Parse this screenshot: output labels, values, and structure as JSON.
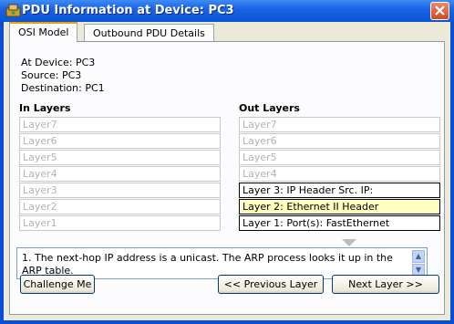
{
  "window": {
    "title": "PDU Information at Device: PC3"
  },
  "tabs": [
    {
      "label": "OSI Model",
      "active": true
    },
    {
      "label": "Outbound PDU Details",
      "active": false
    }
  ],
  "info": {
    "device": "At Device: PC3",
    "source": "Source: PC3",
    "destination": "Destination: PC1"
  },
  "in_layers": {
    "header": "In Layers",
    "items": [
      "Layer7",
      "Layer6",
      "Layer5",
      "Layer4",
      "Layer3",
      "Layer2",
      "Layer1"
    ]
  },
  "out_layers": {
    "header": "Out Layers",
    "items": [
      "Layer7",
      "Layer6",
      "Layer5",
      "Layer4",
      "Layer 3: IP Header Src. IP:",
      "Layer 2: Ethernet II Header",
      "Layer 1: Port(s): FastEthernet"
    ]
  },
  "message": {
    "text": "1. The next-hop IP address is a unicast. The ARP process looks it up in the ARP table."
  },
  "buttons": {
    "challenge": "Challenge Me",
    "previous": "<< Previous Layer",
    "next": "Next Layer >>"
  },
  "colors": {
    "highlight": "#ffffc0",
    "title_bar": "#0a55d6"
  }
}
